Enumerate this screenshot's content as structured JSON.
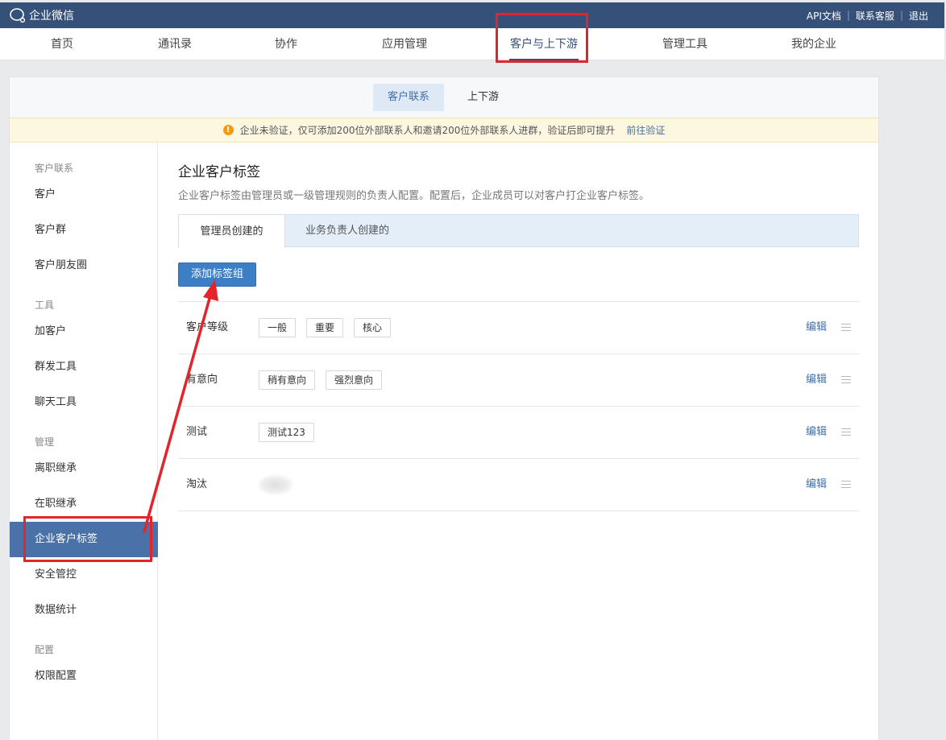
{
  "app": {
    "name": "企业微信"
  },
  "toplinks": [
    "API文档",
    "联系客服",
    "退出"
  ],
  "nav": [
    "首页",
    "通讯录",
    "协作",
    "应用管理",
    "客户与上下游",
    "管理工具",
    "我的企业"
  ],
  "subtabs": [
    "客户联系",
    "上下游"
  ],
  "notice": {
    "text": "企业未验证，仅可添加200位外部联系人和邀请200位外部联系人进群，验证后即可提升",
    "link": "前往验证"
  },
  "sidebar": {
    "groups": [
      "客户联系",
      "工具",
      "管理",
      "配置"
    ],
    "items": [
      "客户",
      "客户群",
      "客户朋友圈",
      "加客户",
      "群发工具",
      "聊天工具",
      "离职继承",
      "在职继承",
      "企业客户标签",
      "安全管控",
      "数据统计",
      "权限配置"
    ]
  },
  "page": {
    "title": "企业客户标签",
    "desc": "企业客户标签由管理员或一级管理规则的负责人配置。配置后，企业成员可以对客户打企业客户标签。",
    "tabs": [
      "管理员创建的",
      "业务负责人创建的"
    ],
    "add_button": "添加标签组",
    "edit_label": "编辑"
  },
  "tag_groups": [
    {
      "name": "客户等级",
      "tags": [
        "一般",
        "重要",
        "核心"
      ]
    },
    {
      "name": "有意向",
      "tags": [
        "稍有意向",
        "强烈意向"
      ]
    },
    {
      "name": "测试",
      "tags": [
        "测试123"
      ]
    },
    {
      "name": "淘汰",
      "tags": []
    }
  ],
  "colors": {
    "header": "#355079",
    "accent": "#3d7fc6",
    "active_sidebar": "#4a72a8",
    "annotation": "#e3242b"
  }
}
